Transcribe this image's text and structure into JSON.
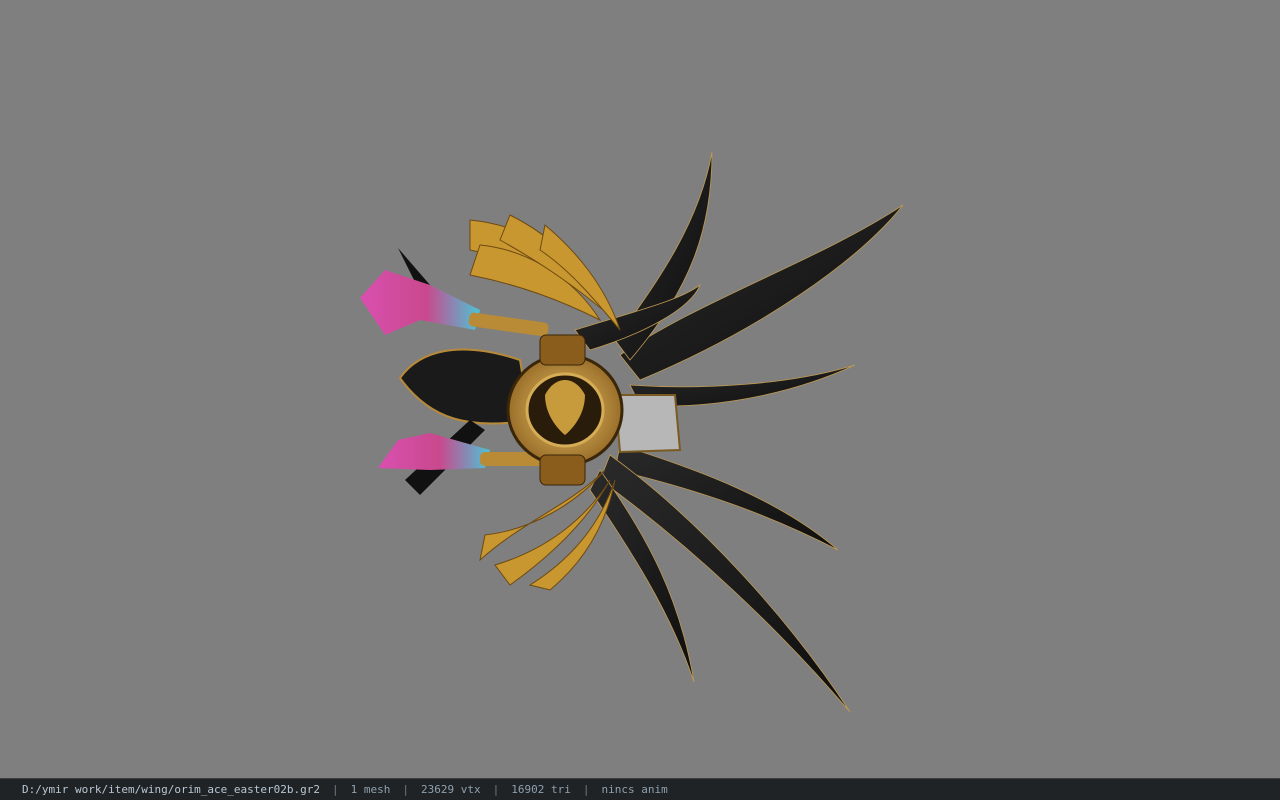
{
  "viewer": {
    "background": "#7f7f7f",
    "model_name": "orim_ace_easter02b wing model"
  },
  "statusbar": {
    "file_path": "D:/ymir work/item/wing/orim_ace_easter02b.gr2",
    "separator": "|",
    "mesh": "1 mesh",
    "vertices": "23629 vtx",
    "triangles": "16902 tri",
    "animation": "nincs anim"
  }
}
